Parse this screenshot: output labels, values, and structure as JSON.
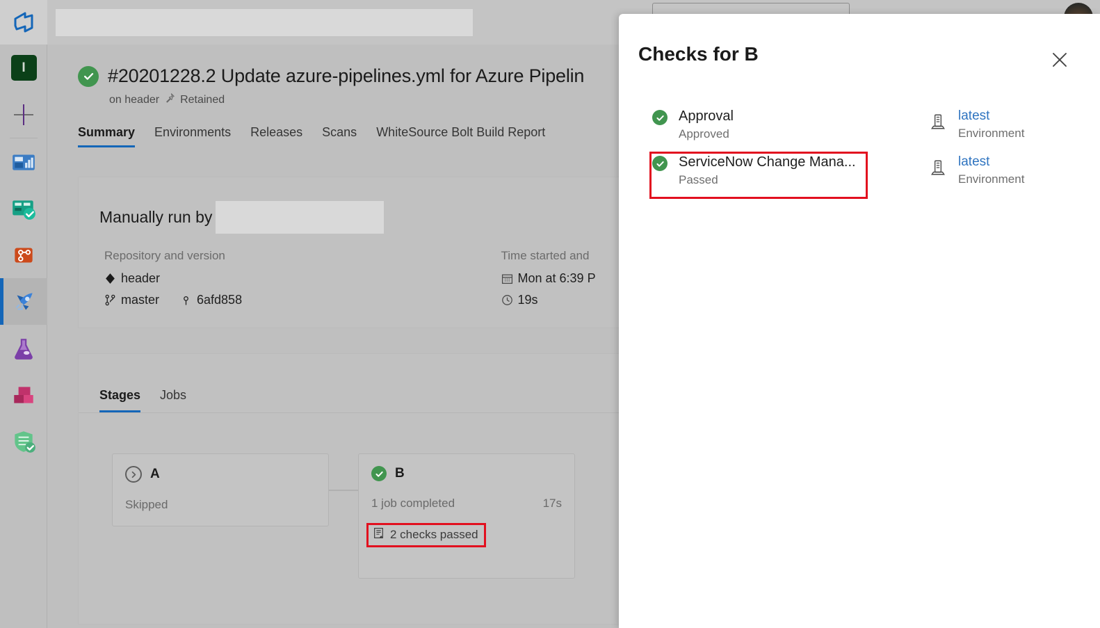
{
  "topbar": {
    "logo_icon": "azure-devops-logo-icon",
    "search_placeholder": "",
    "search_value": "",
    "avatar_label": "",
    "partial_control_label": ""
  },
  "rail": {
    "project_initial": "I",
    "items": [
      {
        "label": "Project",
        "icon": "project-initial-tile",
        "active": false
      },
      {
        "label": "New",
        "icon": "plus-icon",
        "active": false
      },
      {
        "label": "Overview",
        "icon": "overview-dashboard-icon",
        "active": false
      },
      {
        "label": "Boards",
        "icon": "boards-icon",
        "active": false
      },
      {
        "label": "Repos",
        "icon": "repos-branch-icon",
        "active": false
      },
      {
        "label": "Pipelines",
        "icon": "pipelines-rocket-icon",
        "active": true
      },
      {
        "label": "Test Plans",
        "icon": "test-plans-flask-icon",
        "active": false
      },
      {
        "label": "Artifacts",
        "icon": "artifacts-boxes-icon",
        "active": false
      },
      {
        "label": "Security",
        "icon": "security-shield-icon",
        "active": false
      }
    ]
  },
  "run": {
    "status_icon": "success-check-icon",
    "title": "#20201228.2 Update azure-pipelines.yml for Azure Pipelin",
    "branch_text": "on header",
    "retained_icon": "pin-icon",
    "retained_label": "Retained"
  },
  "tabs": [
    {
      "label": "Summary",
      "active": true
    },
    {
      "label": "Environments",
      "active": false
    },
    {
      "label": "Releases",
      "active": false
    },
    {
      "label": "Scans",
      "active": false
    },
    {
      "label": "WhiteSource Bolt Build Report",
      "active": false
    }
  ],
  "run_card": {
    "manually_run_by_label": "Manually run by",
    "manually_run_by_value": "",
    "repo_column": {
      "heading": "Repository and version",
      "repo_icon": "repository-icon",
      "repo_name": "header",
      "branch_icon": "branch-icon",
      "branch_name": "master",
      "commit_icon": "commit-icon",
      "commit_sha": "6afd858"
    },
    "time_column": {
      "heading": "Time started and",
      "calendar_icon": "calendar-icon",
      "started": "Mon at 6:39 P",
      "duration_icon": "clock-icon",
      "duration": "19s"
    }
  },
  "stages_card": {
    "tabs": [
      {
        "label": "Stages",
        "active": true
      },
      {
        "label": "Jobs",
        "active": false
      }
    ],
    "stages": [
      {
        "name": "A",
        "status_icon": "skipped-chevron-circle-icon",
        "status_text": "Skipped",
        "duration": "",
        "checks_icon": "",
        "checks_text": "",
        "annotated": false
      },
      {
        "name": "B",
        "status_icon": "success-check-icon",
        "status_text": "1 job completed",
        "duration": "17s",
        "checks_icon": "checks-clipboard-icon",
        "checks_text": "2 checks passed",
        "annotated": true
      }
    ]
  },
  "checks_panel": {
    "title": "Checks for B",
    "close_icon": "close-icon",
    "checks": [
      {
        "status_icon": "success-check-icon",
        "name": "Approval",
        "status": "Approved",
        "target_icon": "environment-server-icon",
        "target_link": "latest",
        "target_sub": "Environment",
        "annotated": false
      },
      {
        "status_icon": "success-check-icon",
        "name": "ServiceNow Change Mana...",
        "status": "Passed",
        "target_icon": "environment-server-icon",
        "target_link": "latest",
        "target_sub": "Environment",
        "annotated": true
      }
    ]
  },
  "colors": {
    "page_background": "#bfbfbf",
    "panel_background": "#ffffff",
    "success_green": "#41954f",
    "accent_blue": "#1466b8",
    "link_blue": "#2f74c0",
    "annotation_red": "#e2101f",
    "muted_text": "#6e6e6e"
  }
}
